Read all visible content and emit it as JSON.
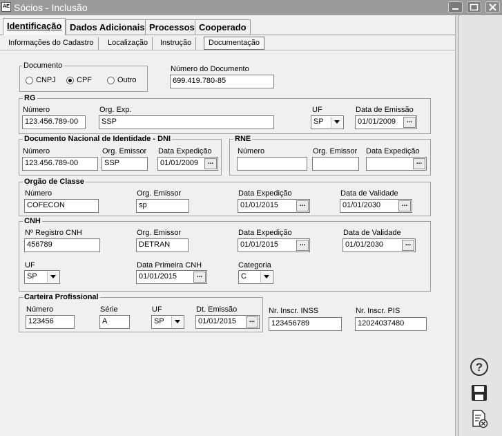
{
  "window": {
    "app_icon": "AE",
    "title": "Sócios - Inclusão"
  },
  "tabs": [
    "Identificação",
    "Dados Adicionais",
    "Processos",
    "Cooperado"
  ],
  "subtabs": [
    "Informações do Cadastro",
    "Localização",
    "Instrução",
    "Documentação"
  ],
  "documento": {
    "title": "Documento",
    "options": [
      "CNPJ",
      "CPF",
      "Outro"
    ],
    "selected": "CPF",
    "numero_label": "Número do Documento",
    "numero_value": "699.419.780-85"
  },
  "rg": {
    "title": "RG",
    "numero_label": "Número",
    "numero_value": "123.456.789-00",
    "org_label": "Org. Exp.",
    "org_value": "SSP",
    "uf_label": "UF",
    "uf_value": "SP",
    "emissao_label": "Data de Emissão",
    "emissao_value": "01/01/2009"
  },
  "dni": {
    "title": "Documento Nacional de Identidade - DNI",
    "numero_label": "Número",
    "numero_value": "123.456.789-00",
    "org_label": "Org. Emissor",
    "org_value": "SSP",
    "exp_label": "Data Expedição",
    "exp_value": "01/01/2009"
  },
  "rne": {
    "title": "RNE",
    "numero_label": "Número",
    "numero_value": "",
    "org_label": "Org. Emissor",
    "org_value": "",
    "exp_label": "Data Expedição",
    "exp_value": ""
  },
  "orgao": {
    "title": "Orgão de Classe",
    "numero_label": "Número",
    "numero_value": "COFECON",
    "org_label": "Org. Emissor",
    "org_value": "sp",
    "exp_label": "Data Expedição",
    "exp_value": "01/01/2015",
    "val_label": "Data de Validade",
    "val_value": "01/01/2030"
  },
  "cnh": {
    "title": "CNH",
    "registro_label": "Nº Registro CNH",
    "registro_value": "456789",
    "org_label": "Org. Emissor",
    "org_value": "DETRAN",
    "exp_label": "Data Expedição",
    "exp_value": "01/01/2015",
    "val_label": "Data de Validade",
    "val_value": "01/01/2030",
    "uf_label": "UF",
    "uf_value": "SP",
    "primeira_label": "Data Primeira CNH",
    "primeira_value": "01/01/2015",
    "cat_label": "Categoria",
    "cat_value": "C"
  },
  "carteira": {
    "title": "Carteira Profissional",
    "numero_label": "Número",
    "numero_value": "123456",
    "serie_label": "Série",
    "serie_value": "A",
    "uf_label": "UF",
    "uf_value": "SP",
    "emissao_label": "Dt. Emissão",
    "emissao_value": "01/01/2015"
  },
  "inss": {
    "label": "Nr. Inscr. INSS",
    "value": "123456789"
  },
  "pis": {
    "label": "Nr. Inscr. PIS",
    "value": "12024037480"
  },
  "date_button": "...",
  "side_icons": [
    "help-icon",
    "save-icon",
    "cancel-document-icon"
  ]
}
